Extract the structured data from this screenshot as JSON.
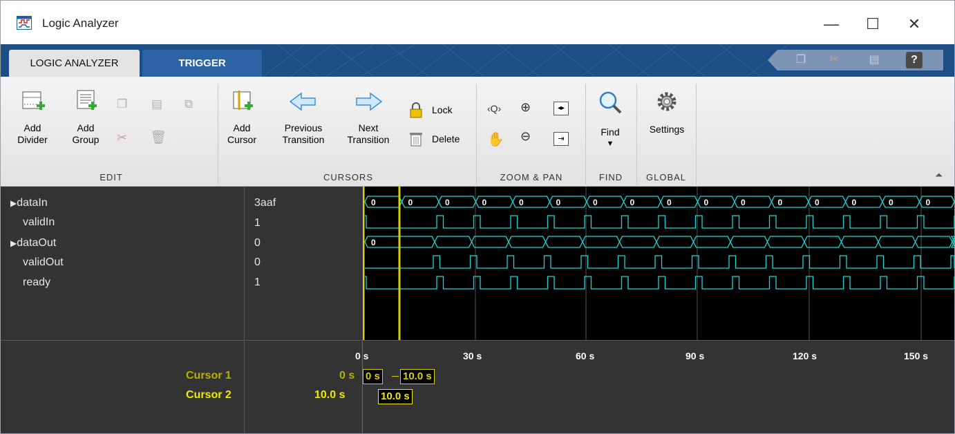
{
  "window": {
    "title": "Logic Analyzer",
    "min_glyph": "—",
    "max_glyph": "☐",
    "close_glyph": "✕"
  },
  "tabs": [
    {
      "label": "LOGIC ANALYZER",
      "active": true
    },
    {
      "label": "TRIGGER",
      "active": false
    }
  ],
  "quick_access": {
    "help_label": "?"
  },
  "toolstrip": {
    "add_divider": [
      "Add",
      "Divider"
    ],
    "add_group": [
      "Add",
      "Group"
    ],
    "add_cursor": [
      "Add",
      "Cursor"
    ],
    "previous_transition": [
      "Previous",
      "Transition"
    ],
    "next_transition": [
      "Next",
      "Transition"
    ],
    "lock": "Lock",
    "delete": "Delete",
    "find": "Find",
    "settings": "Settings",
    "groups": [
      "EDIT",
      "CURSORS",
      "ZOOM & PAN",
      "FIND",
      "GLOBAL"
    ]
  },
  "signals": [
    {
      "name": "dataIn",
      "value": "3aaf",
      "expandable": true
    },
    {
      "name": "validIn",
      "value": "1",
      "expandable": false
    },
    {
      "name": "dataOut",
      "value": "0",
      "expandable": true
    },
    {
      "name": "validOut",
      "value": "0",
      "expandable": false
    },
    {
      "name": "ready",
      "value": "1",
      "expandable": false
    }
  ],
  "waveform": {
    "bus_label": "0",
    "time_ticks": [
      "0 s",
      "30 s",
      "60 s",
      "90 s",
      "120 s",
      "150 s"
    ],
    "colors": {
      "wave": "#1fd6d6",
      "cursor": "#d8d000",
      "background": "#000000"
    }
  },
  "cursors": [
    {
      "name": "Cursor 1",
      "value": "0 s",
      "box": "0 s",
      "delta_box": "10.0 s"
    },
    {
      "name": "Cursor 2",
      "value": "10.0 s",
      "box": "10.0 s"
    }
  ]
}
